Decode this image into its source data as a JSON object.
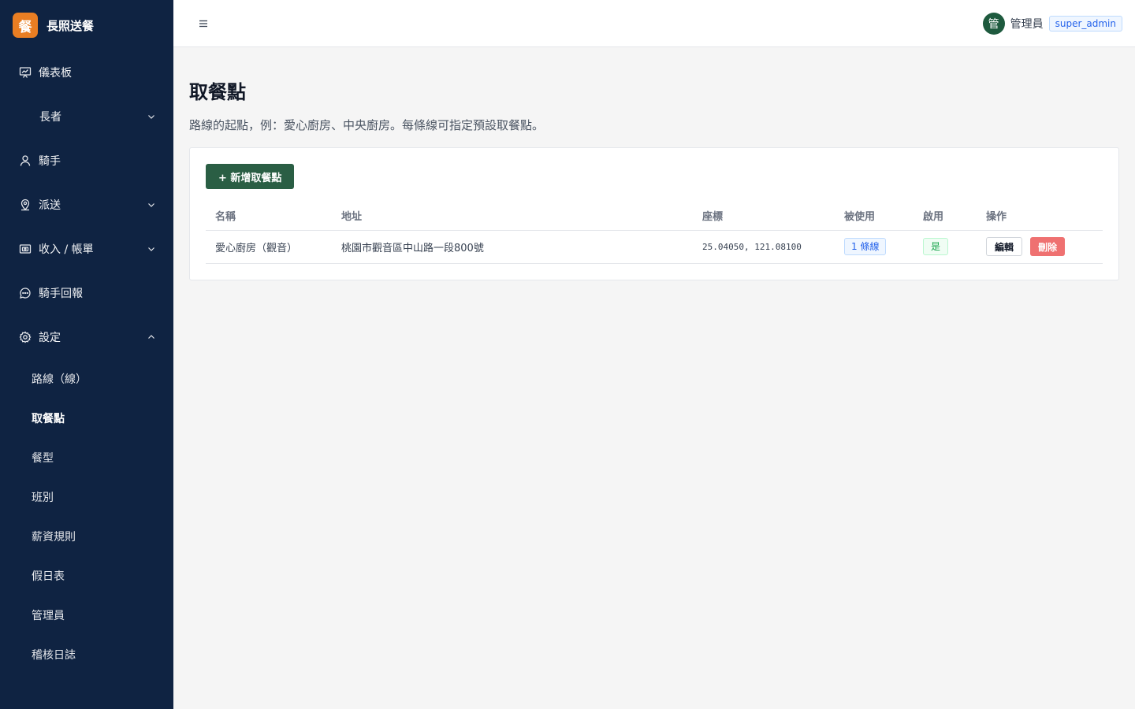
{
  "brand": {
    "logo_char": "餐",
    "title": "長照送餐"
  },
  "sidebar": {
    "items": [
      {
        "label": "儀表板",
        "icon": "dashboard-icon"
      },
      {
        "label": "長者",
        "icon": "",
        "expand": "chevron-down"
      },
      {
        "label": "騎手",
        "icon": "user-icon"
      },
      {
        "label": "派送",
        "icon": "map-pin-icon",
        "expand": "chevron-down"
      },
      {
        "label": "收入 / 帳單",
        "icon": "wallet-icon",
        "expand": "chevron-down"
      },
      {
        "label": "騎手回報",
        "icon": "chat-icon"
      },
      {
        "label": "設定",
        "icon": "gear-icon",
        "expand": "chevron-up"
      }
    ],
    "settings_sub": [
      {
        "label": "路線（線）"
      },
      {
        "label": "取餐點",
        "active": true
      },
      {
        "label": "餐型"
      },
      {
        "label": "班別"
      },
      {
        "label": "薪資規則"
      },
      {
        "label": "假日表"
      },
      {
        "label": "管理員"
      },
      {
        "label": "稽核日誌"
      }
    ]
  },
  "header": {
    "avatar_char": "管",
    "user_name": "管理員",
    "role": "super_admin"
  },
  "page": {
    "title": "取餐點",
    "description": "路線的起點，例：愛心廚房、中央廚房。每條線可指定預設取餐點。",
    "add_button": "+ 新增取餐點"
  },
  "table": {
    "columns": [
      "名稱",
      "地址",
      "座標",
      "被使用",
      "啟用",
      "操作"
    ],
    "rows": [
      {
        "name": "愛心廚房（觀音）",
        "address": "桃園市觀音區中山路一段800號",
        "coords": "25.04050, 121.08100",
        "used_by": "1 條線",
        "enabled": "是",
        "edit": "編輯",
        "delete": "刪除"
      }
    ]
  },
  "colors": {
    "sidebar_bg": "#0f2342",
    "brand_accent": "#e97e23",
    "primary_button": "#2a5e44",
    "danger_button": "#ef7171",
    "info_tag": "#2563eb",
    "success_tag": "#16a34a"
  }
}
